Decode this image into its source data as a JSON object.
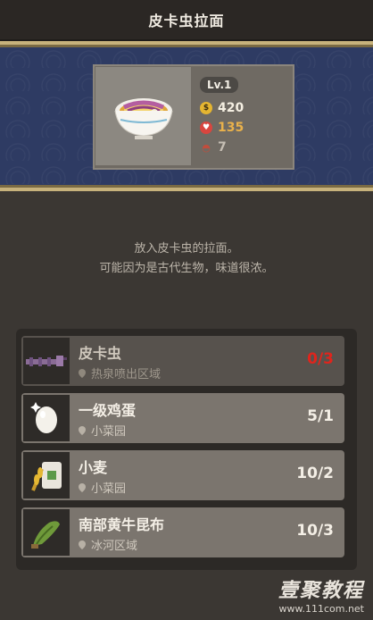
{
  "header": {
    "title": "皮卡虫拉面"
  },
  "dish": {
    "level": "Lv.1",
    "price": "420",
    "appeal": "135",
    "servings": "7",
    "icons": [
      "ramen-bowl-icon",
      "gold-coin-icon",
      "heart-icon",
      "bowl-icon"
    ]
  },
  "description": {
    "line1": "放入皮卡虫的拉面。",
    "line2": "可能因为是古代生物，味道很浓。"
  },
  "ingredients": [
    {
      "name": "皮卡虫",
      "location": "热泉喷出区域",
      "count": "0/3",
      "count_color": "#e0241c",
      "icon": "pika-bug-icon"
    },
    {
      "name": "一级鸡蛋",
      "location": "小菜园",
      "count": "5/1",
      "icon": "egg-icon"
    },
    {
      "name": "小麦",
      "location": "小菜园",
      "count": "10/2",
      "icon": "wheat-sack-icon"
    },
    {
      "name": "南部黄牛昆布",
      "location": "冰河区域",
      "count": "10/3",
      "icon": "kelp-icon"
    }
  ],
  "watermark": {
    "brand": "壹聚教程",
    "url": "www.111com.net"
  },
  "colors": {
    "banner": "#2e3b63",
    "gold_trim": "#c7b27c",
    "shortage": "#e0241c"
  }
}
